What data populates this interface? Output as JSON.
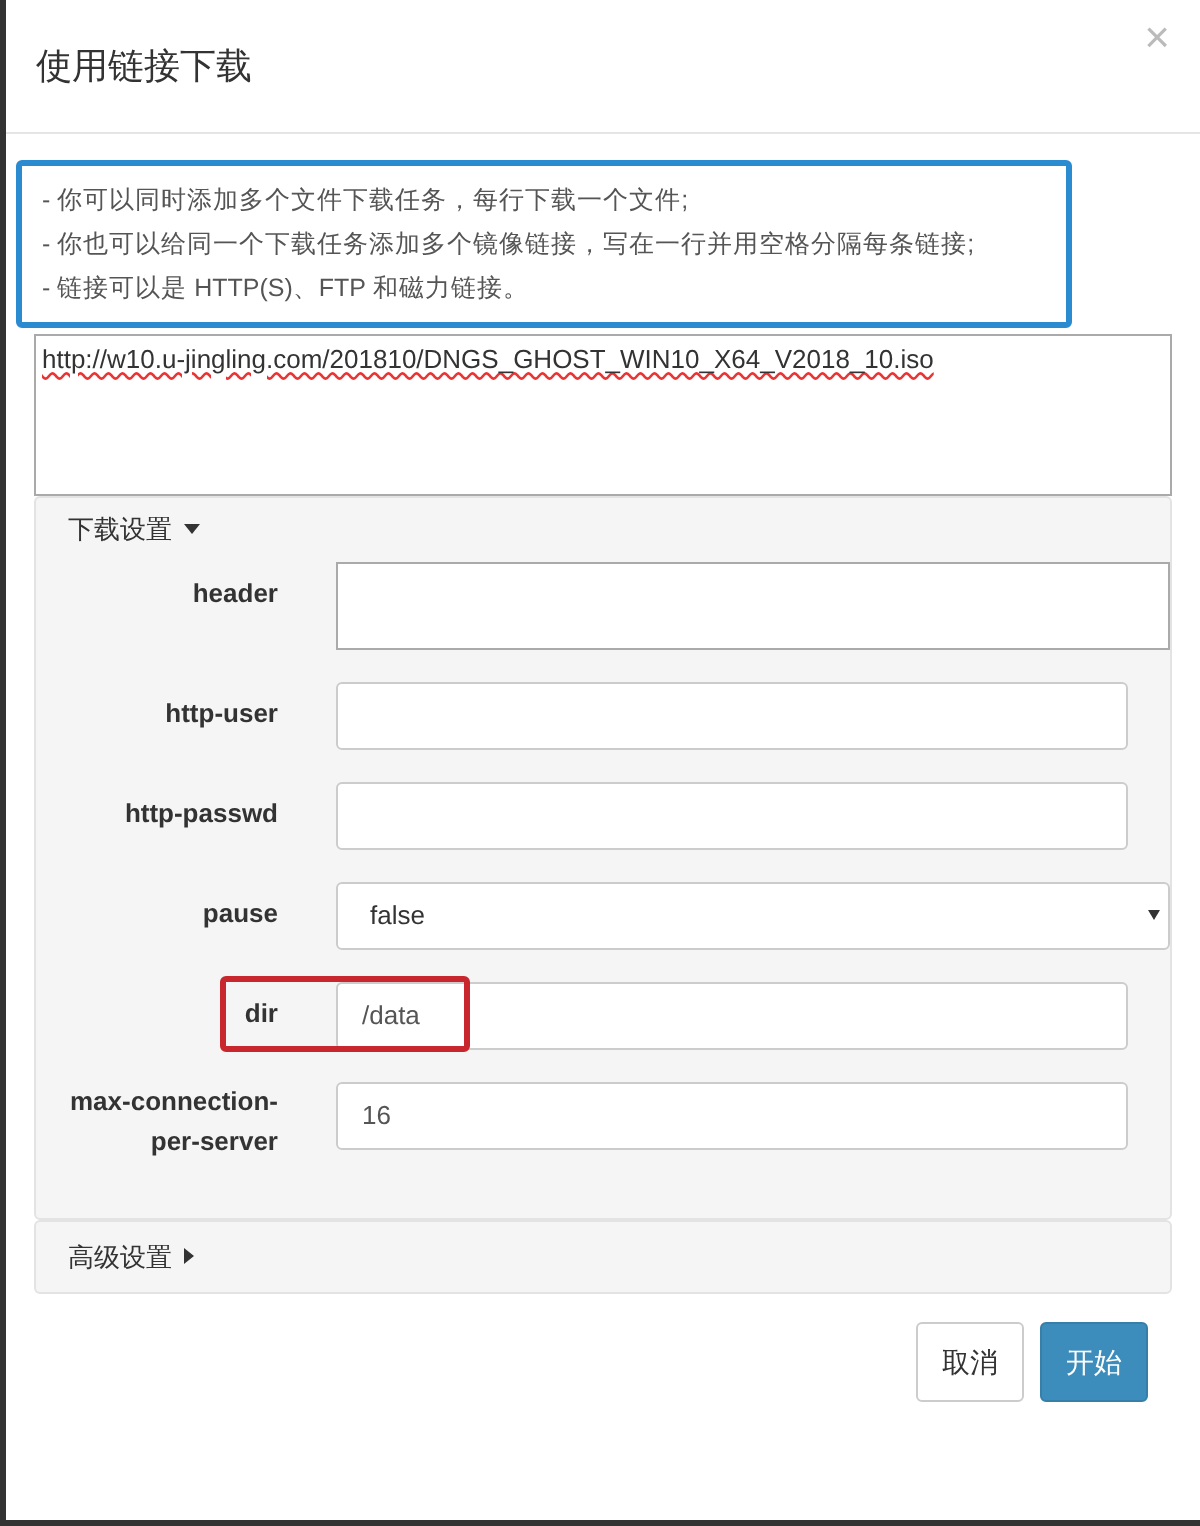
{
  "dialog": {
    "title": "使用链接下载",
    "close": "×"
  },
  "hint": {
    "highlighted": true,
    "lines": [
      "- 你可以同时添加多个文件下载任务，每行下载一个文件;",
      "- 你也可以给同一个下载任务添加多个镜像链接，写在一行并用空格分隔每条链接;",
      "- 链接可以是 HTTP(S)、FTP 和磁力链接。"
    ]
  },
  "urls": {
    "value": "http://w10.u-jingling.com/201810/DNGS_GHOST_WIN10_X64_V2018_10.iso"
  },
  "download_settings": {
    "title": "下载设置",
    "expanded": true,
    "fields": [
      {
        "label": "header",
        "kind": "textarea",
        "highlighted": false
      },
      {
        "label": "http-user",
        "kind": "text",
        "highlighted": false
      },
      {
        "label": "http-passwd",
        "kind": "text",
        "highlighted": false
      },
      {
        "label": "pause",
        "kind": "select",
        "value": "false",
        "highlighted": false
      },
      {
        "label": "dir",
        "kind": "text",
        "value": "/data",
        "highlighted": true
      },
      {
        "label": "max-connection-per-server",
        "kind": "text",
        "value": "16",
        "highlighted": false
      }
    ]
  },
  "advanced_settings": {
    "title": "高级设置",
    "expanded": false
  },
  "buttons": [
    {
      "label": "取消",
      "kind": "default"
    },
    {
      "label": "开始",
      "kind": "primary"
    }
  ]
}
